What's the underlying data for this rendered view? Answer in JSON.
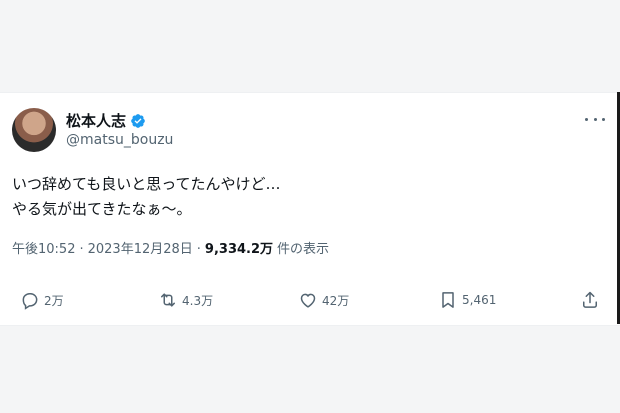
{
  "account": {
    "display_name": "松本人志",
    "handle": "@matsu_bouzu"
  },
  "tweet": {
    "line1": "いつ辞めても良いと思ってたんやけど…",
    "line2": "やる気が出てきたなぁ～。",
    "time": "午後10:52",
    "sep": "·",
    "date": "2023年12月28日",
    "sep2": "·",
    "views": "9,334.2万",
    "views_label": "件の表示"
  },
  "actions": {
    "replies": "2万",
    "reposts": "4.3万",
    "likes": "42万",
    "bookmarks": "5,461"
  },
  "colors": {
    "verified": "#1d9bf0",
    "muted": "#536471",
    "text": "#0f1419"
  }
}
